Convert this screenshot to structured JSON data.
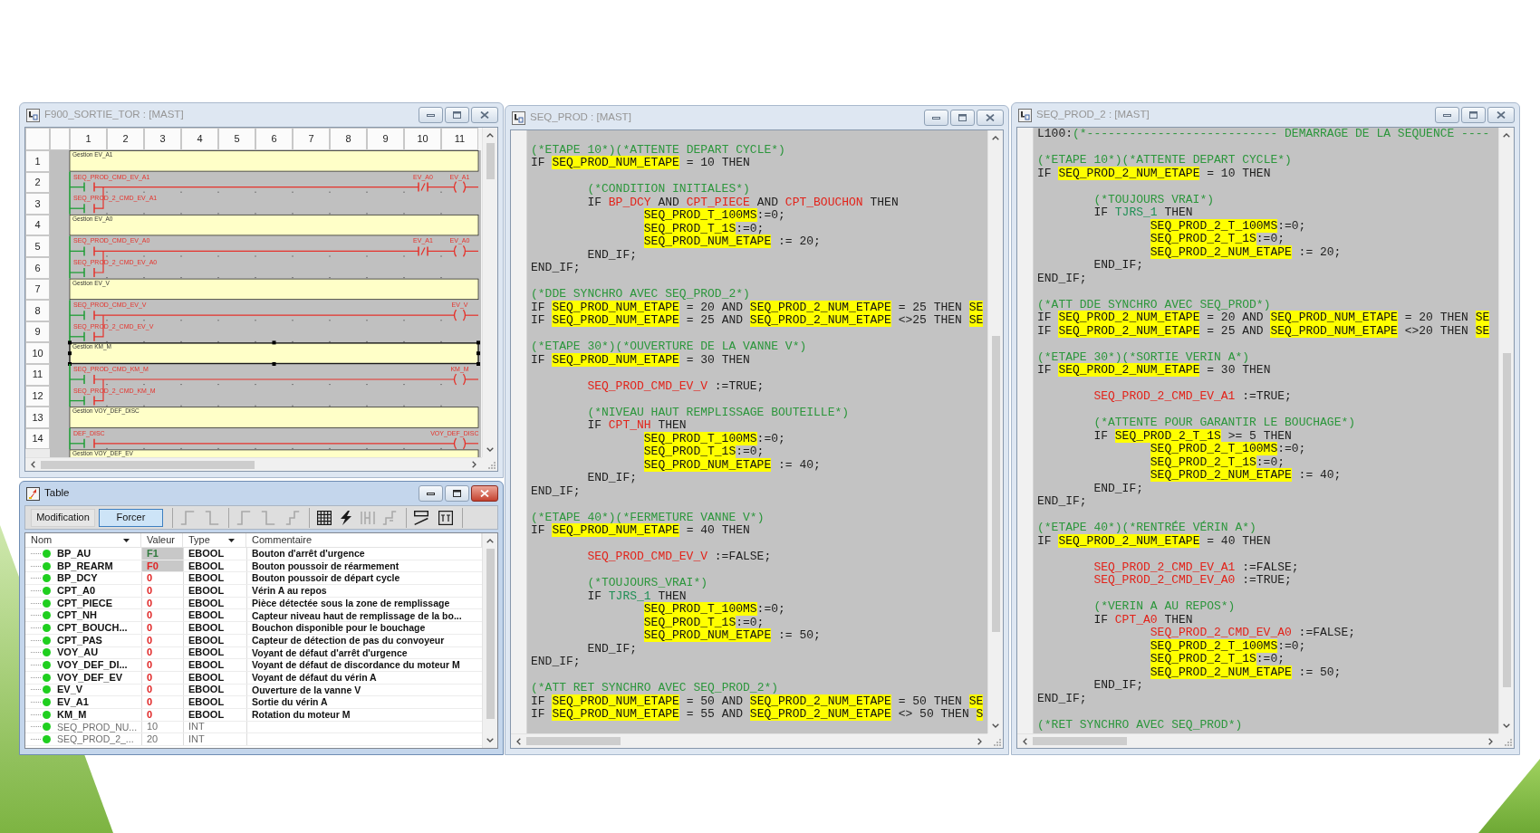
{
  "ladder_window": {
    "title": "F900_SORTIE_TOR : [MAST]",
    "active": false,
    "columns": [
      "1",
      "2",
      "3",
      "4",
      "5",
      "6",
      "7",
      "8",
      "9",
      "10",
      "11"
    ],
    "row_numbers": [
      "1",
      "2",
      "3",
      "4",
      "5",
      "6",
      "7",
      "8",
      "9",
      "10",
      "11",
      "12",
      "13",
      "14"
    ],
    "networks": [
      {
        "kind": "comment",
        "text": "Gestion EV_A1",
        "selected": false
      },
      {
        "kind": "rung",
        "contacts": [
          "SEQ_PROD_CMD_EV_A1",
          "SEQ_PROD_2_CMD_EV_A1"
        ],
        "interlock": "EV_A0",
        "coil": "EV_A1"
      },
      {
        "kind": "comment",
        "text": "Gestion EV_A0",
        "selected": false
      },
      {
        "kind": "rung",
        "contacts": [
          "SEQ_PROD_CMD_EV_A0",
          "SEQ_PROD_2_CMD_EV_A0"
        ],
        "interlock": "EV_A1",
        "coil": "EV_A0"
      },
      {
        "kind": "comment",
        "text": "Gestion EV_V",
        "selected": false
      },
      {
        "kind": "rung",
        "contacts": [
          "SEQ_PROD_CMD_EV_V",
          "SEQ_PROD_2_CMD_EV_V"
        ],
        "coil": "EV_V"
      },
      {
        "kind": "comment",
        "text": "Gestion KM_M",
        "selected": true
      },
      {
        "kind": "rung",
        "contacts": [
          "SEQ_PROD_CMD_KM_M",
          "SEQ_PROD_2_CMD_KM_M"
        ],
        "coil": "KM_M"
      },
      {
        "kind": "comment",
        "text": "Gestion VOY_DEF_DISC",
        "selected": false
      },
      {
        "kind": "rung",
        "contacts": [
          "DEF_DISC"
        ],
        "coil": "VOY_DEF_DISC"
      },
      {
        "kind": "comment",
        "text": "Gestion VOY_DEF_EV",
        "selected": false
      }
    ]
  },
  "table_window": {
    "title": "Table",
    "active": true,
    "mode_buttons": [
      {
        "label": "Modification",
        "selected": false
      },
      {
        "label": "Forcer",
        "selected": true
      }
    ],
    "toolbar_groups": [
      [
        {
          "disabled": true
        },
        {
          "disabled": true
        }
      ],
      [
        {
          "disabled": true
        },
        {
          "disabled": true
        },
        {
          "disabled": true
        }
      ],
      [
        {
          "disabled": false
        },
        {
          "disabled": false
        },
        {
          "disabled": true
        },
        {
          "disabled": true
        }
      ],
      [
        {
          "disabled": false
        },
        {
          "disabled": false
        }
      ]
    ],
    "columns": [
      {
        "label": "Nom",
        "filter": true
      },
      {
        "label": "Valeur",
        "filter": false
      },
      {
        "label": "Type",
        "filter": true
      },
      {
        "label": "Commentaire",
        "filter": false
      }
    ],
    "rows": [
      {
        "kind": "bool",
        "name": "BP_AU",
        "value": "F1",
        "forced": true,
        "on": true,
        "type": "EBOOL",
        "comment": "Bouton d'arrêt d'urgence"
      },
      {
        "kind": "bool",
        "name": "BP_REARM",
        "value": "F0",
        "forced": true,
        "on": false,
        "type": "EBOOL",
        "comment": "Bouton poussoir de réarmement"
      },
      {
        "kind": "bool",
        "name": "BP_DCY",
        "value": "0",
        "forced": false,
        "on": false,
        "type": "EBOOL",
        "comment": "Bouton poussoir de départ cycle"
      },
      {
        "kind": "bool",
        "name": "CPT_A0",
        "value": "0",
        "forced": false,
        "on": false,
        "type": "EBOOL",
        "comment": "Vérin A au repos"
      },
      {
        "kind": "bool",
        "name": "CPT_PIECE",
        "value": "0",
        "forced": false,
        "on": false,
        "type": "EBOOL",
        "comment": "Pièce détectée sous la zone de remplissage"
      },
      {
        "kind": "bool",
        "name": "CPT_NH",
        "value": "0",
        "forced": false,
        "on": false,
        "type": "EBOOL",
        "comment": "Capteur niveau haut de remplissage de la bo..."
      },
      {
        "kind": "bool",
        "name": "CPT_BOUCH...",
        "value": "0",
        "forced": false,
        "on": false,
        "type": "EBOOL",
        "comment": "Bouchon disponible pour le bouchage"
      },
      {
        "kind": "bool",
        "name": "CPT_PAS",
        "value": "0",
        "forced": false,
        "on": false,
        "type": "EBOOL",
        "comment": "Capteur de détection de pas du convoyeur"
      },
      {
        "kind": "bool",
        "name": "VOY_AU",
        "value": "0",
        "forced": false,
        "on": false,
        "type": "EBOOL",
        "comment": "Voyant de défaut d'arrêt d'urgence"
      },
      {
        "kind": "bool",
        "name": "VOY_DEF_DI...",
        "value": "0",
        "forced": false,
        "on": false,
        "type": "EBOOL",
        "comment": "Voyant de défaut de discordance du moteur M"
      },
      {
        "kind": "bool",
        "name": "VOY_DEF_EV",
        "value": "0",
        "forced": false,
        "on": false,
        "type": "EBOOL",
        "comment": "Voyant de défaut du vérin A"
      },
      {
        "kind": "bool",
        "name": "EV_V",
        "value": "0",
        "forced": false,
        "on": false,
        "type": "EBOOL",
        "comment": "Ouverture de la vanne V"
      },
      {
        "kind": "bool",
        "name": "EV_A1",
        "value": "0",
        "forced": false,
        "on": false,
        "type": "EBOOL",
        "comment": "Sortie du vérin A"
      },
      {
        "kind": "bool",
        "name": "KM_M",
        "value": "0",
        "forced": false,
        "on": false,
        "type": "EBOOL",
        "comment": "Rotation du moteur M"
      },
      {
        "kind": "int",
        "name": "SEQ_PROD_NU...",
        "value": "10",
        "forced": false,
        "type": "INT"
      },
      {
        "kind": "int",
        "name": "SEQ_PROD_2_...",
        "value": "20",
        "forced": false,
        "type": "INT"
      }
    ]
  },
  "editors": [
    {
      "title": "SEQ_PROD : [MAST]",
      "active": false,
      "blocks": [
        {
          "lines": [
            [
              {
                "kind": "comment",
                "text": "(*ETAPE 10*)(*ATTENTE DEPART CYCLE*)"
              }
            ],
            [
              {
                "kind": "code",
                "text": "IF "
              },
              {
                "kind": "watched",
                "text": "SEQ_PROD_NUM_ETAPE"
              },
              {
                "kind": "code",
                "text": " = 10 THEN"
              }
            ]
          ]
        },
        {
          "lines": [
            [
              {
                "kind": "tab"
              },
              {
                "kind": "comment",
                "text": "(*CONDITION INITIALES*)"
              }
            ],
            [
              {
                "kind": "tab"
              },
              {
                "kind": "code",
                "text": "IF "
              },
              {
                "kind": "variable",
                "text": "BP_DCY"
              },
              {
                "kind": "code",
                "text": " AND "
              },
              {
                "kind": "variable",
                "text": "CPT_PIECE"
              },
              {
                "kind": "code",
                "text": " AND "
              },
              {
                "kind": "variable",
                "text": "CPT_BOUCHON"
              },
              {
                "kind": "code",
                "text": " THEN"
              }
            ],
            [
              {
                "kind": "tab"
              },
              {
                "kind": "tab"
              },
              {
                "kind": "watched",
                "text": "SEQ_PROD_T_100MS"
              },
              {
                "kind": "code",
                "text": ":=0;"
              }
            ],
            [
              {
                "kind": "tab"
              },
              {
                "kind": "tab"
              },
              {
                "kind": "watched",
                "text": "SEQ_PROD_T_1S"
              },
              {
                "kind": "code",
                "text": ":=0;"
              }
            ],
            [
              {
                "kind": "tab"
              },
              {
                "kind": "tab"
              },
              {
                "kind": "watched",
                "text": "SEQ_PROD_NUM_ETAPE"
              },
              {
                "kind": "code",
                "text": " := 20;"
              }
            ],
            [
              {
                "kind": "tab"
              },
              {
                "kind": "code",
                "text": "END_IF;"
              }
            ],
            [
              {
                "kind": "code",
                "text": "END_IF;"
              }
            ]
          ]
        },
        {
          "lines": [
            [
              {
                "kind": "comment",
                "text": "(*DDE SYNCHRO AVEC SEQ_PROD_2*)"
              }
            ],
            [
              {
                "kind": "code",
                "text": "IF "
              },
              {
                "kind": "watched",
                "text": "SEQ_PROD_NUM_ETAPE"
              },
              {
                "kind": "code",
                "text": " = 20 AND "
              },
              {
                "kind": "watched",
                "text": "SEQ_PROD_2_NUM_ETAPE"
              },
              {
                "kind": "code",
                "text": " = 25 THEN "
              },
              {
                "kind": "watched",
                "text": "SE"
              }
            ],
            [
              {
                "kind": "code",
                "text": "IF "
              },
              {
                "kind": "watched",
                "text": "SEQ_PROD_NUM_ETAPE"
              },
              {
                "kind": "code",
                "text": " = 25 AND "
              },
              {
                "kind": "watched",
                "text": "SEQ_PROD_2_NUM_ETAPE"
              },
              {
                "kind": "code",
                "text": " <>25 THEN "
              },
              {
                "kind": "watched",
                "text": "SE"
              }
            ]
          ]
        },
        {
          "lines": [
            [
              {
                "kind": "comment",
                "text": "(*ETAPE 30*)(*OUVERTURE DE LA VANNE V*)"
              }
            ],
            [
              {
                "kind": "code",
                "text": "IF "
              },
              {
                "kind": "watched",
                "text": "SEQ_PROD_NUM_ETAPE"
              },
              {
                "kind": "code",
                "text": " = 30 THEN"
              }
            ]
          ]
        },
        {
          "lines": [
            [
              {
                "kind": "tab"
              },
              {
                "kind": "variable",
                "text": "SEQ_PROD_CMD_EV_V"
              },
              {
                "kind": "code",
                "text": " :=TRUE;"
              }
            ]
          ]
        },
        {
          "lines": [
            [
              {
                "kind": "tab"
              },
              {
                "kind": "comment",
                "text": "(*NIVEAU HAUT REMPLISSAGE BOUTEILLE*)"
              }
            ],
            [
              {
                "kind": "tab"
              },
              {
                "kind": "code",
                "text": "IF "
              },
              {
                "kind": "variable",
                "text": "CPT_NH"
              },
              {
                "kind": "code",
                "text": " THEN"
              }
            ],
            [
              {
                "kind": "tab"
              },
              {
                "kind": "tab"
              },
              {
                "kind": "watched",
                "text": "SEQ_PROD_T_100MS"
              },
              {
                "kind": "code",
                "text": ":=0;"
              }
            ],
            [
              {
                "kind": "tab"
              },
              {
                "kind": "tab"
              },
              {
                "kind": "watched",
                "text": "SEQ_PROD_T_1S"
              },
              {
                "kind": "code",
                "text": ":=0;"
              }
            ],
            [
              {
                "kind": "tab"
              },
              {
                "kind": "tab"
              },
              {
                "kind": "watched",
                "text": "SEQ_PROD_NUM_ETAPE"
              },
              {
                "kind": "code",
                "text": " := 40;"
              }
            ],
            [
              {
                "kind": "tab"
              },
              {
                "kind": "code",
                "text": "END_IF;"
              }
            ],
            [
              {
                "kind": "code",
                "text": "END_IF;"
              }
            ]
          ]
        },
        {
          "lines": [
            [
              {
                "kind": "comment",
                "text": "(*ETAPE 40*)(*FERMETURE VANNE V*)"
              }
            ],
            [
              {
                "kind": "code",
                "text": "IF "
              },
              {
                "kind": "watched",
                "text": "SEQ_PROD_NUM_ETAPE"
              },
              {
                "kind": "code",
                "text": " = 40 THEN"
              }
            ]
          ]
        },
        {
          "lines": [
            [
              {
                "kind": "tab"
              },
              {
                "kind": "variable",
                "text": "SEQ_PROD_CMD_EV_V"
              },
              {
                "kind": "code",
                "text": " :=FALSE;"
              }
            ]
          ]
        },
        {
          "lines": [
            [
              {
                "kind": "tab"
              },
              {
                "kind": "comment",
                "text": "(*TOUJOURS_VRAI*)"
              }
            ],
            [
              {
                "kind": "tab"
              },
              {
                "kind": "code",
                "text": "IF "
              },
              {
                "kind": "constant",
                "text": "TJRS_1"
              },
              {
                "kind": "code",
                "text": " THEN"
              }
            ],
            [
              {
                "kind": "tab"
              },
              {
                "kind": "tab"
              },
              {
                "kind": "watched",
                "text": "SEQ_PROD_T_100MS"
              },
              {
                "kind": "code",
                "text": ":=0;"
              }
            ],
            [
              {
                "kind": "tab"
              },
              {
                "kind": "tab"
              },
              {
                "kind": "watched",
                "text": "SEQ_PROD_T_1S"
              },
              {
                "kind": "code",
                "text": ":=0;"
              }
            ],
            [
              {
                "kind": "tab"
              },
              {
                "kind": "tab"
              },
              {
                "kind": "watched",
                "text": "SEQ_PROD_NUM_ETAPE"
              },
              {
                "kind": "code",
                "text": " := 50;"
              }
            ],
            [
              {
                "kind": "tab"
              },
              {
                "kind": "code",
                "text": "END_IF;"
              }
            ],
            [
              {
                "kind": "code",
                "text": "END_IF;"
              }
            ]
          ]
        },
        {
          "lines": [
            [
              {
                "kind": "comment",
                "text": "(*ATT RET SYNCHRO AVEC SEQ_PROD_2*)"
              }
            ],
            [
              {
                "kind": "code",
                "text": "IF "
              },
              {
                "kind": "watched",
                "text": "SEQ_PROD_NUM_ETAPE"
              },
              {
                "kind": "code",
                "text": " = 50 AND "
              },
              {
                "kind": "watched",
                "text": "SEQ_PROD_2_NUM_ETAPE"
              },
              {
                "kind": "code",
                "text": " = 50 THEN "
              },
              {
                "kind": "watched",
                "text": "SE"
              }
            ],
            [
              {
                "kind": "code",
                "text": "IF "
              },
              {
                "kind": "watched",
                "text": "SEQ_PROD_NUM_ETAPE"
              },
              {
                "kind": "code",
                "text": " = 55 AND "
              },
              {
                "kind": "watched",
                "text": "SEQ_PROD_2_NUM_ETAPE"
              },
              {
                "kind": "code",
                "text": " <> 50 THEN "
              },
              {
                "kind": "watched",
                "text": "S"
              }
            ]
          ]
        }
      ]
    },
    {
      "title": "SEQ_PROD_2 : [MAST]",
      "active": false,
      "blocks": [
        {
          "lines": [
            [
              {
                "kind": "code",
                "text": "L100:"
              },
              {
                "kind": "comment",
                "text": "(*--------------------------- DEMARRAGE DE LA SEQUENCE ----"
              }
            ]
          ]
        },
        {
          "lines": [
            [
              {
                "kind": "comment",
                "text": "(*ETAPE 10*)(*ATTENTE DEPART CYCLE*)"
              }
            ],
            [
              {
                "kind": "code",
                "text": "IF "
              },
              {
                "kind": "watched",
                "text": "SEQ_PROD_2_NUM_ETAPE"
              },
              {
                "kind": "code",
                "text": " = 10 THEN"
              }
            ]
          ]
        },
        {
          "lines": [
            [
              {
                "kind": "tab"
              },
              {
                "kind": "comment",
                "text": "(*TOUJOURS VRAI*)"
              }
            ],
            [
              {
                "kind": "tab"
              },
              {
                "kind": "code",
                "text": "IF "
              },
              {
                "kind": "constant",
                "text": "TJRS_1"
              },
              {
                "kind": "code",
                "text": " THEN"
              }
            ],
            [
              {
                "kind": "tab"
              },
              {
                "kind": "tab"
              },
              {
                "kind": "watched",
                "text": "SEQ_PROD_2_T_100MS"
              },
              {
                "kind": "code",
                "text": ":=0;"
              }
            ],
            [
              {
                "kind": "tab"
              },
              {
                "kind": "tab"
              },
              {
                "kind": "watched",
                "text": "SEQ_PROD_2_T_1S"
              },
              {
                "kind": "code",
                "text": ":=0;"
              }
            ],
            [
              {
                "kind": "tab"
              },
              {
                "kind": "tab"
              },
              {
                "kind": "watched",
                "text": "SEQ_PROD_2_NUM_ETAPE"
              },
              {
                "kind": "code",
                "text": " := 20;"
              }
            ],
            [
              {
                "kind": "tab"
              },
              {
                "kind": "code",
                "text": "END_IF;"
              }
            ],
            [
              {
                "kind": "code",
                "text": "END_IF;"
              }
            ]
          ]
        },
        {
          "lines": [
            [
              {
                "kind": "comment",
                "text": "(*ATT DDE SYNCHRO AVEC SEQ_PROD*)"
              }
            ],
            [
              {
                "kind": "code",
                "text": "IF "
              },
              {
                "kind": "watched",
                "text": "SEQ_PROD_2_NUM_ETAPE"
              },
              {
                "kind": "code",
                "text": " = 20 AND "
              },
              {
                "kind": "watched",
                "text": "SEQ_PROD_NUM_ETAPE"
              },
              {
                "kind": "code",
                "text": " = 20 THEN "
              },
              {
                "kind": "watched",
                "text": "SE"
              }
            ],
            [
              {
                "kind": "code",
                "text": "IF "
              },
              {
                "kind": "watched",
                "text": "SEQ_PROD_2_NUM_ETAPE"
              },
              {
                "kind": "code",
                "text": " = 25 AND "
              },
              {
                "kind": "watched",
                "text": "SEQ_PROD_NUM_ETAPE"
              },
              {
                "kind": "code",
                "text": " <>20 THEN "
              },
              {
                "kind": "watched",
                "text": "SE"
              }
            ]
          ]
        },
        {
          "lines": [
            [
              {
                "kind": "comment",
                "text": "(*ETAPE 30*)(*SORTIE VERIN A*)"
              }
            ],
            [
              {
                "kind": "code",
                "text": "IF "
              },
              {
                "kind": "watched",
                "text": "SEQ_PROD_2_NUM_ETAPE"
              },
              {
                "kind": "code",
                "text": " = 30 THEN"
              }
            ]
          ]
        },
        {
          "lines": [
            [
              {
                "kind": "tab"
              },
              {
                "kind": "variable",
                "text": "SEQ_PROD_2_CMD_EV_A1"
              },
              {
                "kind": "code",
                "text": " :=TRUE;"
              }
            ]
          ]
        },
        {
          "lines": [
            [
              {
                "kind": "tab"
              },
              {
                "kind": "comment",
                "text": "(*ATTENTE POUR GARANTIR LE BOUCHAGE*)"
              }
            ],
            [
              {
                "kind": "tab"
              },
              {
                "kind": "code",
                "text": "IF "
              },
              {
                "kind": "watched",
                "text": "SEQ_PROD_2_T_1S"
              },
              {
                "kind": "code",
                "text": " >= 5 THEN"
              }
            ],
            [
              {
                "kind": "tab"
              },
              {
                "kind": "tab"
              },
              {
                "kind": "watched",
                "text": "SEQ_PROD_2_T_100MS"
              },
              {
                "kind": "code",
                "text": ":=0;"
              }
            ],
            [
              {
                "kind": "tab"
              },
              {
                "kind": "tab"
              },
              {
                "kind": "watched",
                "text": "SEQ_PROD_2_T_1S"
              },
              {
                "kind": "code",
                "text": ":=0;"
              }
            ],
            [
              {
                "kind": "tab"
              },
              {
                "kind": "tab"
              },
              {
                "kind": "watched",
                "text": "SEQ_PROD_2_NUM_ETAPE"
              },
              {
                "kind": "code",
                "text": " := 40;"
              }
            ],
            [
              {
                "kind": "tab"
              },
              {
                "kind": "code",
                "text": "END_IF;"
              }
            ],
            [
              {
                "kind": "code",
                "text": "END_IF;"
              }
            ]
          ]
        },
        {
          "lines": [
            [
              {
                "kind": "comment",
                "text": "(*ETAPE 40*)(*RENTRÉE VÉRIN A*)"
              }
            ],
            [
              {
                "kind": "code",
                "text": "IF "
              },
              {
                "kind": "watched",
                "text": "SEQ_PROD_2_NUM_ETAPE"
              },
              {
                "kind": "code",
                "text": " = 40 THEN"
              }
            ]
          ]
        },
        {
          "lines": [
            [
              {
                "kind": "tab"
              },
              {
                "kind": "variable",
                "text": "SEQ_PROD_2_CMD_EV_A1"
              },
              {
                "kind": "code",
                "text": " :=FALSE;"
              }
            ],
            [
              {
                "kind": "tab"
              },
              {
                "kind": "variable",
                "text": "SEQ_PROD_2_CMD_EV_A0"
              },
              {
                "kind": "code",
                "text": " :=TRUE;"
              }
            ]
          ]
        },
        {
          "lines": [
            [
              {
                "kind": "tab"
              },
              {
                "kind": "comment",
                "text": "(*VERIN A AU REPOS*)"
              }
            ],
            [
              {
                "kind": "tab"
              },
              {
                "kind": "code",
                "text": "IF "
              },
              {
                "kind": "variable",
                "text": "CPT_A0"
              },
              {
                "kind": "code",
                "text": " THEN"
              }
            ],
            [
              {
                "kind": "tab"
              },
              {
                "kind": "tab"
              },
              {
                "kind": "variable",
                "text": "SEQ_PROD_2_CMD_EV_A0"
              },
              {
                "kind": "code",
                "text": " :=FALSE;"
              }
            ],
            [
              {
                "kind": "tab"
              },
              {
                "kind": "tab"
              },
              {
                "kind": "watched",
                "text": "SEQ_PROD_2_T_100MS"
              },
              {
                "kind": "code",
                "text": ":=0;"
              }
            ],
            [
              {
                "kind": "tab"
              },
              {
                "kind": "tab"
              },
              {
                "kind": "watched",
                "text": "SEQ_PROD_2_T_1S"
              },
              {
                "kind": "code",
                "text": ":=0;"
              }
            ],
            [
              {
                "kind": "tab"
              },
              {
                "kind": "tab"
              },
              {
                "kind": "watched",
                "text": "SEQ_PROD_2_NUM_ETAPE"
              },
              {
                "kind": "code",
                "text": " := 50;"
              }
            ],
            [
              {
                "kind": "tab"
              },
              {
                "kind": "code",
                "text": "END_IF;"
              }
            ],
            [
              {
                "kind": "code",
                "text": "END_IF;"
              }
            ]
          ]
        },
        {
          "lines": [
            [
              {
                "kind": "comment",
                "text": "(*RET SYNCHRO AVEC SEQ_PROD*)"
              }
            ]
          ]
        }
      ]
    }
  ]
}
